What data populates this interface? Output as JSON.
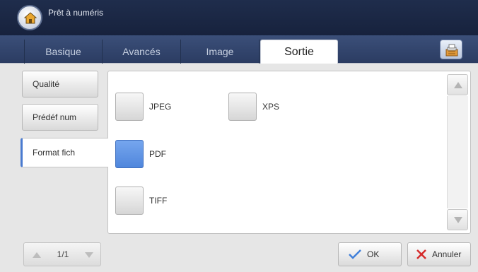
{
  "header": {
    "title": "Prêt à numéris"
  },
  "tabs": [
    {
      "label": "Basique"
    },
    {
      "label": "Avancés"
    },
    {
      "label": "Image"
    },
    {
      "label": "Sortie"
    }
  ],
  "sidebar": {
    "items": [
      {
        "label": "Qualité"
      },
      {
        "label": "Prédéf num"
      },
      {
        "label": "Format fich"
      }
    ]
  },
  "formats": {
    "jpeg": {
      "label": "JPEG",
      "selected": false
    },
    "xps": {
      "label": "XPS",
      "selected": false
    },
    "pdf": {
      "label": "PDF",
      "selected": true
    },
    "tiff": {
      "label": "TIFF",
      "selected": false
    }
  },
  "pager": {
    "text": "1/1"
  },
  "buttons": {
    "ok": "OK",
    "cancel": "Annuler"
  },
  "colors": {
    "header": "#1f2d4c",
    "tabbar": "#3b4f79",
    "selected": "#5a8fe0",
    "ok_check": "#3f7fd9",
    "cancel_x": "#d52b2b"
  }
}
